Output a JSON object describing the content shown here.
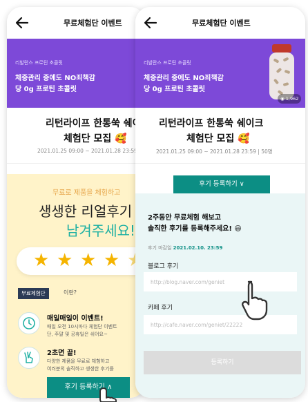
{
  "back_screen": {
    "header_title": "무료체험단 이벤트",
    "banner": {
      "brand_label": "리발란스 프로틴 초콜릿",
      "headline_1": "체중관리 중에도 NO죄책감",
      "headline_2": "당 0g 프로틴 초콜릿"
    },
    "event_title_1": "리턴라이프 한통쑥 쉐이",
    "event_title_2": "체험단 모집 🥰",
    "event_period": "2021.01.25 09:00 ~ 2021.01.28 23:59",
    "promo": {
      "subtitle": "무료로 제품을 체험하고",
      "headline_1": "생생한 리얼후기",
      "headline_2": "남겨주세요!",
      "tag": "무료체험단",
      "tag_tail": "이란?"
    },
    "features": [
      {
        "title": "매일매일이 이벤트!",
        "desc_1": "매일 오전 10시마다 체험단 이벤트",
        "desc_2": "단, 주말 및 공휴일은 쉬어요~"
      },
      {
        "title": "2초면 끝!",
        "desc_1": "다양한 제품을 무료로 체험하고",
        "desc_2": "여러분의 솔직하고 생생한 후기를"
      }
    ],
    "bottom_button": "후기 등록하기 ∧"
  },
  "front_screen": {
    "header_title": "무료체험단 이벤트",
    "banner": {
      "brand_label": "리발란스 프로틴 초콜릿",
      "headline_1": "체중관리 중에도 NO죄책감",
      "headline_2": "당 0g 프로틴 초콜릿",
      "view_count": "1,962"
    },
    "event_title_1": "리턴라이프 한통쑥 쉐이크",
    "event_title_2": "체험단 모집 🥰",
    "event_period": "2021.01.25 09:00 ~ 2021.01.28 23:59  |  50명",
    "review_tab": "후기 등록하기 ∨",
    "guide_1": "2주동안 무료체험 해보고",
    "guide_2": "솔직한 후기를 등록해주세요! 😃",
    "deadline_label": "후기 마감일",
    "deadline_date": "2021.02.10. 23:59",
    "blog_label": "블로그 후기",
    "blog_placeholder": "http://blog.naver.com/geniet",
    "cafe_label": "카페 후기",
    "cafe_placeholder": "http://cafe.naver.com/geniet/22222",
    "submit_label": "등록하기"
  },
  "colors": {
    "banner_purple": "#7d49d8",
    "teal": "#0c8e84",
    "promo_yellow": "#fff3c9",
    "star_gold": "#f5b400"
  }
}
